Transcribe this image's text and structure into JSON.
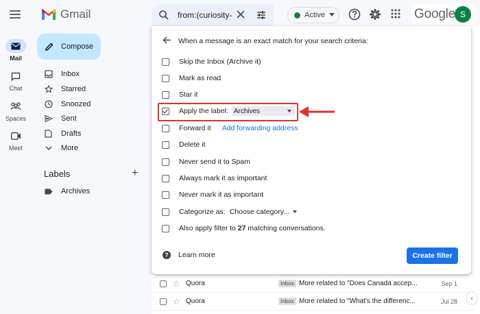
{
  "header": {
    "app_name": "Gmail",
    "search_query": "from:(curiosity-",
    "status_label": "Active",
    "brand": "Google",
    "avatar_initial": "S"
  },
  "rail": {
    "items": [
      {
        "label": "Mail",
        "icon": "mail-icon",
        "active": true
      },
      {
        "label": "Chat",
        "icon": "chat-icon",
        "active": false
      },
      {
        "label": "Spaces",
        "icon": "spaces-icon",
        "active": false
      },
      {
        "label": "Meet",
        "icon": "meet-icon",
        "active": false
      }
    ]
  },
  "sidebar": {
    "compose_label": "Compose",
    "items": [
      {
        "label": "Inbox",
        "icon": "inbox-icon"
      },
      {
        "label": "Starred",
        "icon": "star-icon"
      },
      {
        "label": "Snoozed",
        "icon": "clock-icon"
      },
      {
        "label": "Sent",
        "icon": "send-icon"
      },
      {
        "label": "Drafts",
        "icon": "draft-icon"
      },
      {
        "label": "More",
        "icon": "chevron-down-icon"
      }
    ],
    "labels_header": "Labels",
    "labels": [
      {
        "label": "Archives",
        "icon": "label-icon"
      }
    ]
  },
  "filter": {
    "title": "When a message is an exact match for your search criteria:",
    "options": [
      {
        "label": "Skip the Inbox (Archive it)",
        "checked": false
      },
      {
        "label": "Mark as read",
        "checked": false
      },
      {
        "label": "Star it",
        "checked": false
      },
      {
        "label": "Apply the label:",
        "checked": true,
        "select_value": "Archives"
      },
      {
        "label": "Forward it",
        "checked": false,
        "link": "Add forwarding address"
      },
      {
        "label": "Delete it",
        "checked": false
      },
      {
        "label": "Never send it to Spam",
        "checked": false
      },
      {
        "label": "Always mark it as important",
        "checked": false
      },
      {
        "label": "Never mark it as important",
        "checked": false
      },
      {
        "label": "Categorize as:",
        "checked": false,
        "select_value": "Choose category..."
      },
      {
        "label_pre": "Also apply filter to ",
        "count": "27",
        "label_post": " matching conversations.",
        "checked": false
      }
    ],
    "learn_more": "Learn more",
    "create_button": "Create filter"
  },
  "mail_list": [
    {
      "from": "Quora",
      "badge": "Inbox",
      "subject": "More related to \"Does Canada accep...",
      "date": "Sep 1"
    },
    {
      "from": "Quora",
      "badge": "Inbox",
      "subject": "More related to \"What's the differenc...",
      "date": "Jul 28"
    }
  ],
  "colors": {
    "accent": "#1a73e8",
    "compose_bg": "#c2e7ff",
    "highlight": "#e0312d",
    "status_green": "#188038"
  }
}
